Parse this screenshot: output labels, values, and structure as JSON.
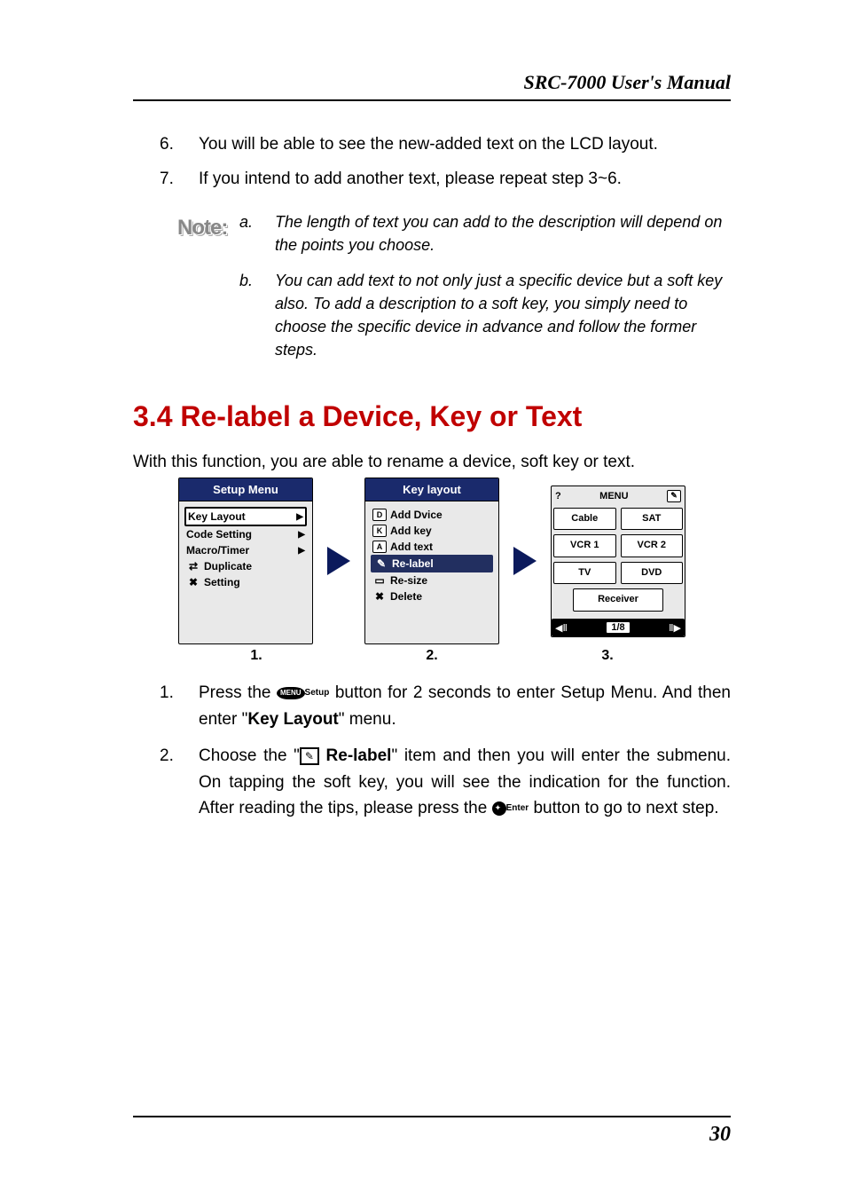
{
  "header": {
    "title": "SRC-7000 User's Manual"
  },
  "top_list": [
    {
      "n": "6.",
      "text": "You will be able to see the new-added text on the LCD layout."
    },
    {
      "n": "7.",
      "text": "If you intend to add another text, please repeat step 3~6."
    }
  ],
  "note": {
    "label": "Note:",
    "items": [
      {
        "l": "a.",
        "text": "The length of text you can add to the description will depend on the points you choose."
      },
      {
        "l": "b.",
        "text": "You can add text to not only just a specific device but a soft key also. To add a description to a soft key, you simply need to choose the specific device in advance and follow the former steps."
      }
    ]
  },
  "section": {
    "title": "3.4 Re-label a Device, Key or Text"
  },
  "intro": "With this function, you are able to rename a device, soft key or text.",
  "screen1": {
    "title": "Setup Menu",
    "items": [
      {
        "label": "Key Layout",
        "arrow": true,
        "selected": true
      },
      {
        "label": "Code Setting",
        "arrow": true
      },
      {
        "label": "Macro/Timer",
        "arrow": true
      },
      {
        "label": "Duplicate",
        "icon": "⇄"
      },
      {
        "label": "Setting",
        "icon": "✖"
      }
    ]
  },
  "screen2": {
    "title": "Key layout",
    "items": [
      {
        "box": "D",
        "label": "Add Dvice"
      },
      {
        "box": "K",
        "label": "Add key"
      },
      {
        "box": "A",
        "label": "Add text"
      },
      {
        "icon": "✎",
        "label": "Re-label",
        "inv": true
      },
      {
        "icon": "▭",
        "label": "Re-size"
      },
      {
        "icon": "✖",
        "label": "Delete"
      }
    ]
  },
  "screen3": {
    "topbar": {
      "help": "?",
      "menu": "MENU",
      "edit": "✎"
    },
    "devices": [
      "Cable",
      "SAT",
      "VCR 1",
      "VCR 2",
      "TV",
      "DVD"
    ],
    "receiver": "Receiver",
    "pager": {
      "left": "◀",
      "page": "1/8",
      "right": "▶"
    }
  },
  "captions": [
    "1.",
    "2.",
    "3."
  ],
  "steps": [
    {
      "n": "1.",
      "pre": "Press the ",
      "btn": "MENU",
      "btn_label": "Setup",
      "mid": " button for 2 seconds to enter Setup Menu. And then enter \"",
      "bold": "Key Layout",
      "post": "\" menu."
    },
    {
      "n": "2.",
      "pre": "Choose the \"",
      "icon": "✎",
      "bold": " Re-label",
      "mid": "\" item and then you will enter the submenu. On tapping the soft key, you will see the indication for the function. After reading the tips, please press the ",
      "btn_label": "Enter",
      "post": " button to go to next step."
    }
  ],
  "footer": {
    "page": "30"
  }
}
